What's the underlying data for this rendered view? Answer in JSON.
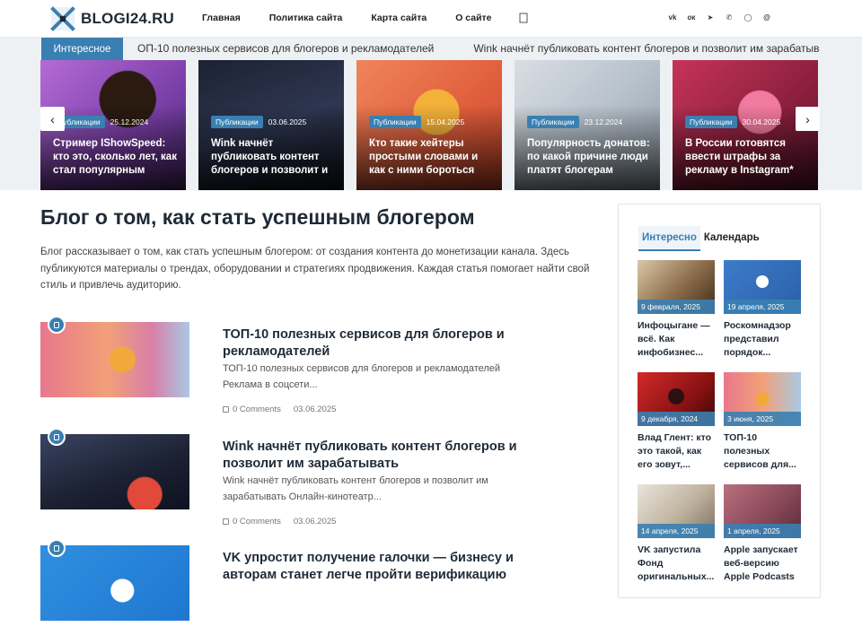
{
  "site": {
    "logo": "BLOGI24.RU"
  },
  "nav": [
    {
      "label": "Главная"
    },
    {
      "label": "Политика сайта"
    },
    {
      "label": "Карта сайта"
    },
    {
      "label": "О сайте"
    }
  ],
  "socials": [
    {
      "icon": "vk-icon",
      "glyph": "vk"
    },
    {
      "icon": "odnoklassniki-icon",
      "glyph": "ок"
    },
    {
      "icon": "telegram-icon",
      "glyph": "➤"
    },
    {
      "icon": "viber-icon",
      "glyph": "✆"
    },
    {
      "icon": "whatsapp-icon",
      "glyph": "◯"
    },
    {
      "icon": "mail-icon",
      "glyph": "@"
    }
  ],
  "ticker": {
    "label": "Интересное",
    "items": [
      "ОП-10 полезных сервисов для блогеров и рекламодателей",
      "Wink начнёт публиковать контент блогеров и позволит им зарабатывать"
    ]
  },
  "slider": [
    {
      "badge": "Публикации",
      "date": "25.12.2024",
      "title": "Стример IShowSpeed: кто это, сколько лет, как стал популярным"
    },
    {
      "badge": "Публикации",
      "date": "03.06.2025",
      "title": "Wink начнёт публиковать контент блогеров и позволит и"
    },
    {
      "badge": "Публикации",
      "date": "15.04.2025",
      "title": "Кто такие хейтеры простыми словами и как с ними бороться"
    },
    {
      "badge": "Публикации",
      "date": "23.12.2024",
      "title": "Популярность донатов: по какой причине люди платят блогерам"
    },
    {
      "badge": "Публикации",
      "date": "30.04.2025",
      "title": "В России готовятся ввести штрафы за рекламу в Instagram*"
    }
  ],
  "main": {
    "title": "Блог о том, как стать успешным блогером",
    "description": "Блог рассказывает о том, как стать успешным блогером: от создания контента до монетизации канала. Здесь публикуются материалы о трендах, оборудовании и стратегиях продвижения. Каждая статья помогает найти свой стиль и привлечь аудиторию."
  },
  "posts": [
    {
      "title": "ТОП-10 полезных сервисов для блогеров и рекламодателей",
      "excerpt": "ТОП-10 полезных сервисов для блогеров и рекламодателей Реклама в соцсети...",
      "comments": "0 Comments",
      "date": "03.06.2025"
    },
    {
      "title": "Wink начнёт публиковать контент блогеров и позволит им зарабатывать",
      "excerpt": "Wink начнёт публиковать контент блогеров и позволит им зарабатывать Онлайн-кинотеатр...",
      "comments": "0 Comments",
      "date": "03.06.2025"
    },
    {
      "title": "VK упростит получение галочки — бизнесу и авторам станет легче пройти верификацию",
      "excerpt": "",
      "comments": "",
      "date": ""
    }
  ],
  "sidebar": {
    "tabs": [
      {
        "label": "Интересно",
        "active": true
      },
      {
        "label": "Календарь",
        "active": false
      }
    ],
    "items": [
      {
        "date": "9 февраля, 2025",
        "title": "Инфоцыгане — всё. Как инфобизнес..."
      },
      {
        "date": "19 апреля, 2025",
        "title": "Роскомнадзор представил порядок..."
      },
      {
        "date": "9 декабря, 2024",
        "title": "Влад Глент: кто это такой, как его зовут,..."
      },
      {
        "date": "3 июня, 2025",
        "title": "ТОП-10 полезных сервисов для..."
      },
      {
        "date": "14 апреля, 2025",
        "title": "VK запустила Фонд оригинальных..."
      },
      {
        "date": "1 апреля, 2025",
        "title": "Apple запускает веб-версию Apple Podcasts"
      }
    ]
  },
  "colors": {
    "accent": "#3a7fb1",
    "dark": "#1f2a36"
  }
}
